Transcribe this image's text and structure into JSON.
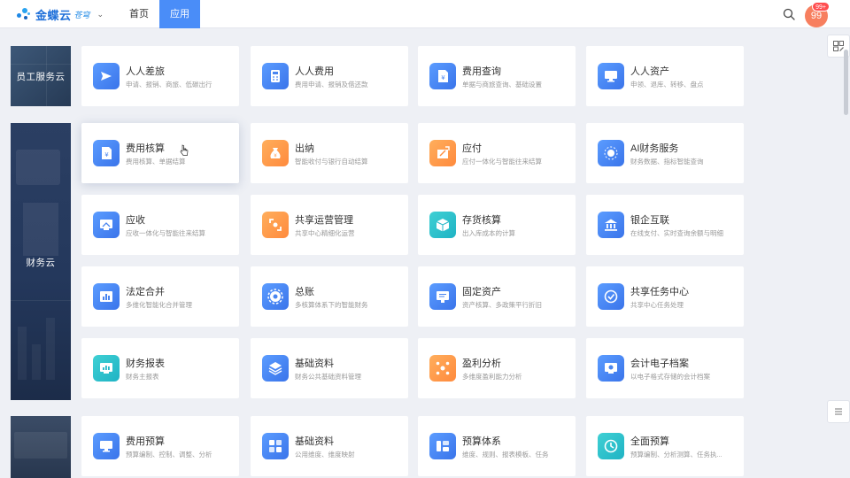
{
  "header": {
    "logo_text": "金蝶云",
    "logo_sub": "苍穹",
    "caret": "⌄",
    "tabs": [
      {
        "label": "首页",
        "active": false
      },
      {
        "label": "应用",
        "active": true
      }
    ],
    "avatar_text": "99",
    "badge_text": "99+",
    "accent_color": "#4a8df8"
  },
  "sections": [
    {
      "label": "员工服务云"
    },
    {
      "label": "财务云"
    },
    {
      "label": ""
    }
  ],
  "cards": [
    {
      "title": "人人差旅",
      "desc": "申请、报销、商旅、低碳出行",
      "icon": "send-icon",
      "color": "blue"
    },
    {
      "title": "人人费用",
      "desc": "费用申请、报销及借还款",
      "icon": "calculator-icon",
      "color": "blue"
    },
    {
      "title": "费用查询",
      "desc": "单据与商旅查询、基础设置",
      "icon": "yuan-doc-icon",
      "color": "blue"
    },
    {
      "title": "人人资产",
      "desc": "申领、退库、转移、盘点",
      "icon": "monitor-icon",
      "color": "blue"
    },
    {
      "title": "费用核算",
      "desc": "费用核算、单据结算",
      "icon": "yuan-doc-icon",
      "color": "blue"
    },
    {
      "title": "出纳",
      "desc": "智能收付与银行自动结算",
      "icon": "money-bag-icon",
      "color": "orange"
    },
    {
      "title": "应付",
      "desc": "应付一体化与智能往来结算",
      "icon": "payable-icon",
      "color": "orange"
    },
    {
      "title": "AI财务服务",
      "desc": "财务数据、指标智能查询",
      "icon": "ai-icon",
      "color": "blue"
    },
    {
      "title": "应收",
      "desc": "应收一体化与智能往来结算",
      "icon": "receivable-icon",
      "color": "blue"
    },
    {
      "title": "共享运营管理",
      "desc": "共享中心精细化运营",
      "icon": "shared-ops-icon",
      "color": "orange"
    },
    {
      "title": "存货核算",
      "desc": "出入库成本的计算",
      "icon": "box-icon",
      "color": "teal"
    },
    {
      "title": "银企互联",
      "desc": "在线支付、实时查询余额与明细",
      "icon": "bank-icon",
      "color": "blue"
    },
    {
      "title": "法定合并",
      "desc": "多维化智能化合并管理",
      "icon": "merge-chart-icon",
      "color": "blue"
    },
    {
      "title": "总账",
      "desc": "多核算体系下的智能财务",
      "icon": "ledger-gear-icon",
      "color": "blue"
    },
    {
      "title": "固定资产",
      "desc": "资产核算、多政策平行折旧",
      "icon": "screen-icon",
      "color": "blue"
    },
    {
      "title": "共享任务中心",
      "desc": "共享中心任务处理",
      "icon": "task-icon",
      "color": "blue"
    },
    {
      "title": "财务报表",
      "desc": "财务主报表",
      "icon": "report-icon",
      "color": "teal"
    },
    {
      "title": "基础资料",
      "desc": "财务公共基础资料管理",
      "icon": "layers-icon",
      "color": "blue"
    },
    {
      "title": "盈利分析",
      "desc": "多维度盈利能力分析",
      "icon": "network-icon",
      "color": "orange"
    },
    {
      "title": "会计电子档案",
      "desc": "以电子格式存储的会计档案",
      "icon": "archive-icon",
      "color": "blue"
    },
    {
      "title": "费用预算",
      "desc": "预算编制、控制、调整、分析",
      "icon": "monitor-icon",
      "color": "blue"
    },
    {
      "title": "基础资料",
      "desc": "公用维度、维度映射",
      "icon": "grid-icon",
      "color": "blue"
    },
    {
      "title": "预算体系",
      "desc": "维度、规则、报表模板、任务",
      "icon": "bars-icon",
      "color": "blue"
    },
    {
      "title": "全面预算",
      "desc": "预算编制、分析测算、任务执...",
      "icon": "cycle-icon",
      "color": "teal"
    }
  ]
}
